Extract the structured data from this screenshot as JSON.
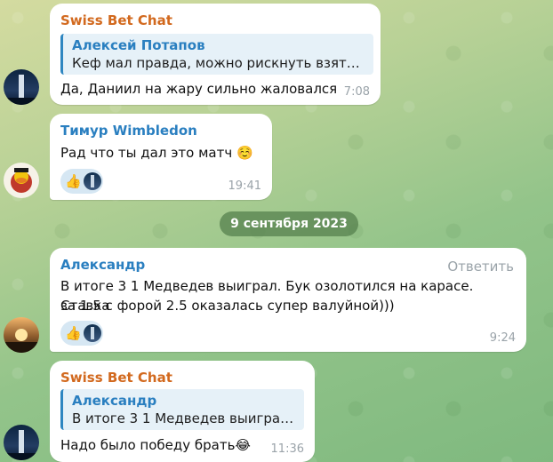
{
  "colors": {
    "swiss_bet_chat": "#d2691e",
    "timur": "#2a7fc0",
    "aleksandr": "#2a7fc0",
    "reply_bar": "#2e86c1",
    "bubble_bg": "#ffffff",
    "reaction_bg": "#d6e7f3"
  },
  "messages": [
    {
      "sender": "Swiss Bet Chat",
      "reply": {
        "author": "Алексей Потапов",
        "text": "Кеф мал правда, можно рискнуть взять ..."
      },
      "text": "Да, Даниил на жару сильно жаловался",
      "time": "7:08",
      "avatar_icon": "tower-avatar"
    },
    {
      "sender": "Тимур Wimbledon",
      "text": "Рад что ты дал это матч ☺️",
      "time": "19:41",
      "reactions": [
        {
          "emoji": "👍",
          "icon": "thumbs-up-icon"
        }
      ],
      "avatar_icon": "duck-avatar"
    },
    {
      "sender": "Александр",
      "action": "Ответить",
      "text_lines": [
        "В итоге 3 1 Медведев выиграл. Бук озолотился на карасе. Ставка",
        "за 1.5 с форой 2.5 оказалась супер валуйной)))"
      ],
      "time": "9:24",
      "reactions": [
        {
          "emoji": "👍",
          "icon": "thumbs-up-icon"
        }
      ],
      "avatar_icon": "sunset-avatar"
    },
    {
      "sender": "Swiss Bet Chat",
      "reply": {
        "author": "Александр",
        "text": "В итоге 3 1 Медведев выиграл...."
      },
      "text": "Надо было победу брать😂",
      "time": "11:36",
      "avatar_icon": "tower-avatar"
    }
  ],
  "date_separator": "9 сентября 2023"
}
